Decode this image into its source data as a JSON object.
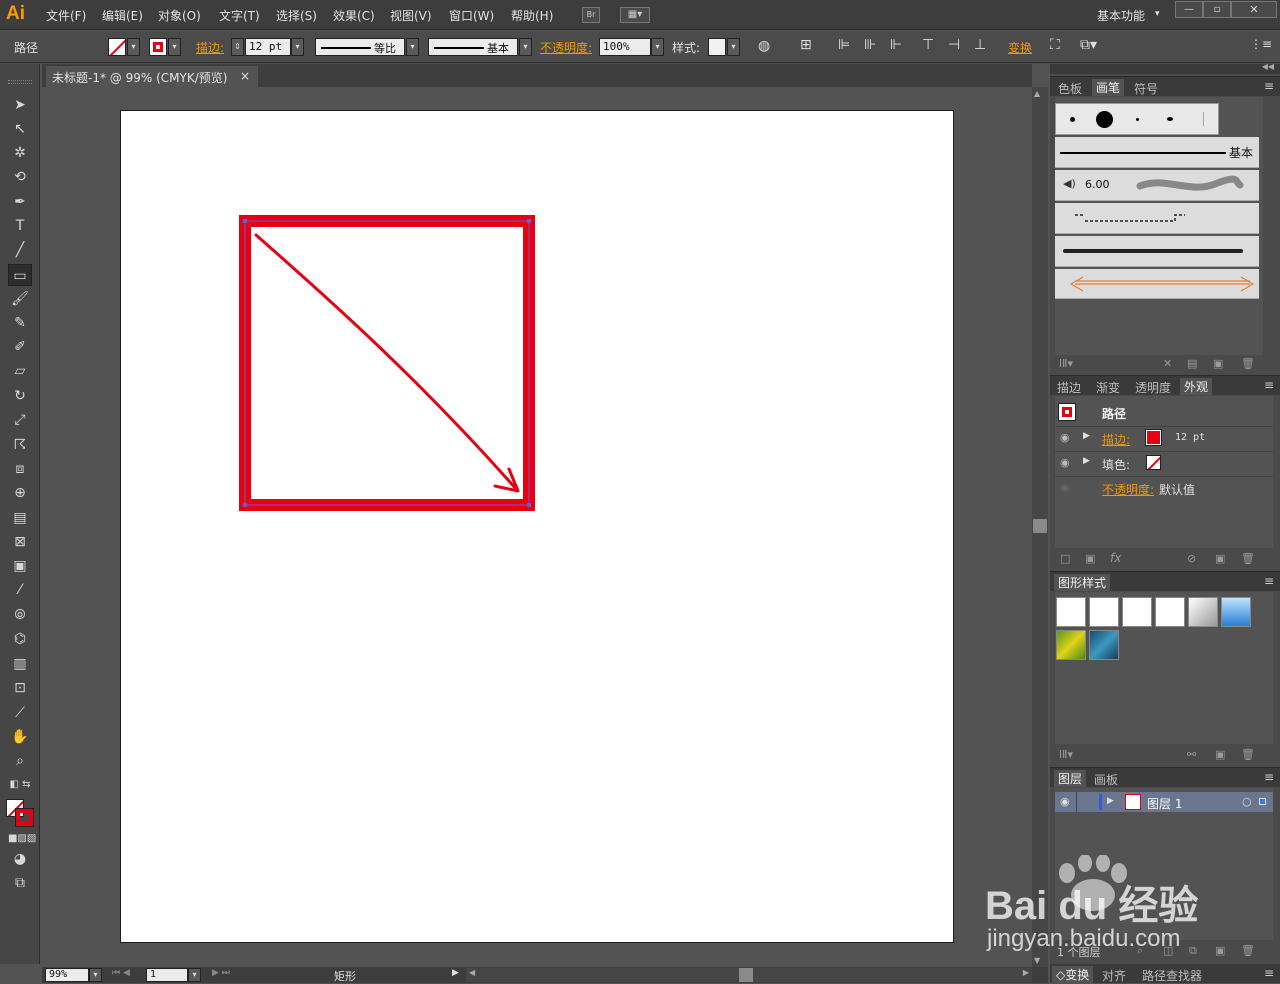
{
  "app": {
    "logo": "Ai"
  },
  "menu": [
    "文件(F)",
    "编辑(E)",
    "对象(O)",
    "文字(T)",
    "选择(S)",
    "效果(C)",
    "视图(V)",
    "窗口(W)",
    "帮助(H)"
  ],
  "bridge_label": "Br",
  "workspace": {
    "label": "基本功能",
    "arrow": "▾"
  },
  "window_controls": {
    "minimize": "—",
    "restore": "▫",
    "close": "✕"
  },
  "control_bar": {
    "selection_type": "路径",
    "stroke_label": "描边:",
    "stroke_weight": "12 pt",
    "profile_label": "等比",
    "brush_label": "基本",
    "opacity_label": "不透明度:",
    "opacity_value": "100%",
    "style_label": "样式:",
    "transform_label": "变换"
  },
  "document": {
    "tab_title": "未标题-1* @ 99% (CMYK/预览)",
    "close": "×"
  },
  "status": {
    "zoom": "99%",
    "artboard": "1",
    "tool": "矩形"
  },
  "brush_panel": {
    "tabs": [
      "色板",
      "画笔",
      "符号"
    ],
    "active": "画笔",
    "basic_label": "基本",
    "size_label": "6.00"
  },
  "appearance_panel": {
    "tabs": [
      "描边",
      "渐变",
      "透明度",
      "外观"
    ],
    "active": "外观",
    "title": "路径",
    "rows": [
      {
        "label": "描边:",
        "value": "12 pt"
      },
      {
        "label": "填色:",
        "value": ""
      },
      {
        "label": "不透明度:",
        "value": "默认值"
      }
    ],
    "fx": "fx"
  },
  "graphic_styles": {
    "title": "图形样式"
  },
  "layers": {
    "tabs": [
      "图层",
      "画板"
    ],
    "layer_name": "图层 1",
    "count": "1 个图层"
  },
  "bottom_tabs": [
    "◇变换",
    "对齐",
    "路径查找器"
  ],
  "colors": {
    "accent": "#f39800",
    "stroke_red": "#e60012",
    "panel": "#535353"
  },
  "watermark": {
    "brand": "Bai du 经验",
    "url": "jingyan.baidu.com"
  }
}
